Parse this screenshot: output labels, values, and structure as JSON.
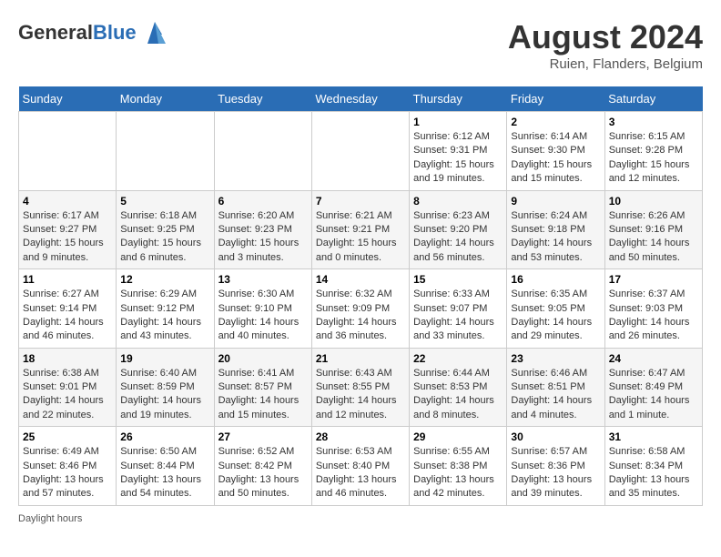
{
  "header": {
    "logo_general": "General",
    "logo_blue": "Blue",
    "title": "August 2024",
    "location": "Ruien, Flanders, Belgium"
  },
  "weekdays": [
    "Sunday",
    "Monday",
    "Tuesday",
    "Wednesday",
    "Thursday",
    "Friday",
    "Saturday"
  ],
  "weeks": [
    [
      {
        "day": "",
        "info": ""
      },
      {
        "day": "",
        "info": ""
      },
      {
        "day": "",
        "info": ""
      },
      {
        "day": "",
        "info": ""
      },
      {
        "day": "1",
        "info": "Sunrise: 6:12 AM\nSunset: 9:31 PM\nDaylight: 15 hours\nand 19 minutes."
      },
      {
        "day": "2",
        "info": "Sunrise: 6:14 AM\nSunset: 9:30 PM\nDaylight: 15 hours\nand 15 minutes."
      },
      {
        "day": "3",
        "info": "Sunrise: 6:15 AM\nSunset: 9:28 PM\nDaylight: 15 hours\nand 12 minutes."
      }
    ],
    [
      {
        "day": "4",
        "info": "Sunrise: 6:17 AM\nSunset: 9:27 PM\nDaylight: 15 hours\nand 9 minutes."
      },
      {
        "day": "5",
        "info": "Sunrise: 6:18 AM\nSunset: 9:25 PM\nDaylight: 15 hours\nand 6 minutes."
      },
      {
        "day": "6",
        "info": "Sunrise: 6:20 AM\nSunset: 9:23 PM\nDaylight: 15 hours\nand 3 minutes."
      },
      {
        "day": "7",
        "info": "Sunrise: 6:21 AM\nSunset: 9:21 PM\nDaylight: 15 hours\nand 0 minutes."
      },
      {
        "day": "8",
        "info": "Sunrise: 6:23 AM\nSunset: 9:20 PM\nDaylight: 14 hours\nand 56 minutes."
      },
      {
        "day": "9",
        "info": "Sunrise: 6:24 AM\nSunset: 9:18 PM\nDaylight: 14 hours\nand 53 minutes."
      },
      {
        "day": "10",
        "info": "Sunrise: 6:26 AM\nSunset: 9:16 PM\nDaylight: 14 hours\nand 50 minutes."
      }
    ],
    [
      {
        "day": "11",
        "info": "Sunrise: 6:27 AM\nSunset: 9:14 PM\nDaylight: 14 hours\nand 46 minutes."
      },
      {
        "day": "12",
        "info": "Sunrise: 6:29 AM\nSunset: 9:12 PM\nDaylight: 14 hours\nand 43 minutes."
      },
      {
        "day": "13",
        "info": "Sunrise: 6:30 AM\nSunset: 9:10 PM\nDaylight: 14 hours\nand 40 minutes."
      },
      {
        "day": "14",
        "info": "Sunrise: 6:32 AM\nSunset: 9:09 PM\nDaylight: 14 hours\nand 36 minutes."
      },
      {
        "day": "15",
        "info": "Sunrise: 6:33 AM\nSunset: 9:07 PM\nDaylight: 14 hours\nand 33 minutes."
      },
      {
        "day": "16",
        "info": "Sunrise: 6:35 AM\nSunset: 9:05 PM\nDaylight: 14 hours\nand 29 minutes."
      },
      {
        "day": "17",
        "info": "Sunrise: 6:37 AM\nSunset: 9:03 PM\nDaylight: 14 hours\nand 26 minutes."
      }
    ],
    [
      {
        "day": "18",
        "info": "Sunrise: 6:38 AM\nSunset: 9:01 PM\nDaylight: 14 hours\nand 22 minutes."
      },
      {
        "day": "19",
        "info": "Sunrise: 6:40 AM\nSunset: 8:59 PM\nDaylight: 14 hours\nand 19 minutes."
      },
      {
        "day": "20",
        "info": "Sunrise: 6:41 AM\nSunset: 8:57 PM\nDaylight: 14 hours\nand 15 minutes."
      },
      {
        "day": "21",
        "info": "Sunrise: 6:43 AM\nSunset: 8:55 PM\nDaylight: 14 hours\nand 12 minutes."
      },
      {
        "day": "22",
        "info": "Sunrise: 6:44 AM\nSunset: 8:53 PM\nDaylight: 14 hours\nand 8 minutes."
      },
      {
        "day": "23",
        "info": "Sunrise: 6:46 AM\nSunset: 8:51 PM\nDaylight: 14 hours\nand 4 minutes."
      },
      {
        "day": "24",
        "info": "Sunrise: 6:47 AM\nSunset: 8:49 PM\nDaylight: 14 hours\nand 1 minute."
      }
    ],
    [
      {
        "day": "25",
        "info": "Sunrise: 6:49 AM\nSunset: 8:46 PM\nDaylight: 13 hours\nand 57 minutes."
      },
      {
        "day": "26",
        "info": "Sunrise: 6:50 AM\nSunset: 8:44 PM\nDaylight: 13 hours\nand 54 minutes."
      },
      {
        "day": "27",
        "info": "Sunrise: 6:52 AM\nSunset: 8:42 PM\nDaylight: 13 hours\nand 50 minutes."
      },
      {
        "day": "28",
        "info": "Sunrise: 6:53 AM\nSunset: 8:40 PM\nDaylight: 13 hours\nand 46 minutes."
      },
      {
        "day": "29",
        "info": "Sunrise: 6:55 AM\nSunset: 8:38 PM\nDaylight: 13 hours\nand 42 minutes."
      },
      {
        "day": "30",
        "info": "Sunrise: 6:57 AM\nSunset: 8:36 PM\nDaylight: 13 hours\nand 39 minutes."
      },
      {
        "day": "31",
        "info": "Sunrise: 6:58 AM\nSunset: 8:34 PM\nDaylight: 13 hours\nand 35 minutes."
      }
    ]
  ],
  "footer": {
    "label": "Daylight hours"
  }
}
